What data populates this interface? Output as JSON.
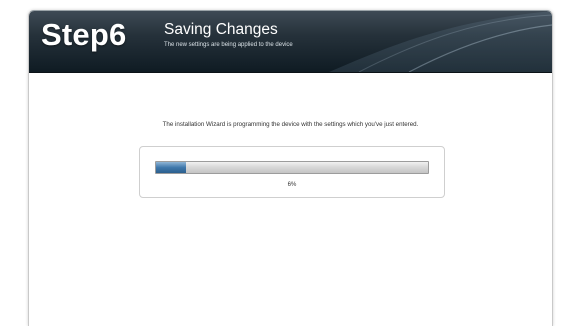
{
  "header": {
    "step_label": "Step6",
    "title": "Saving Changes",
    "subtitle": "The new settings are being applied to the device"
  },
  "main": {
    "message": "The installation Wizard is programming the device with the settings which you've just entered.",
    "progress": {
      "percent": 6,
      "label": "6%"
    }
  },
  "colors": {
    "header_dark": "#0f1b23",
    "progress_fill": "#3f78ab",
    "progress_track": "#d9d9d9"
  }
}
